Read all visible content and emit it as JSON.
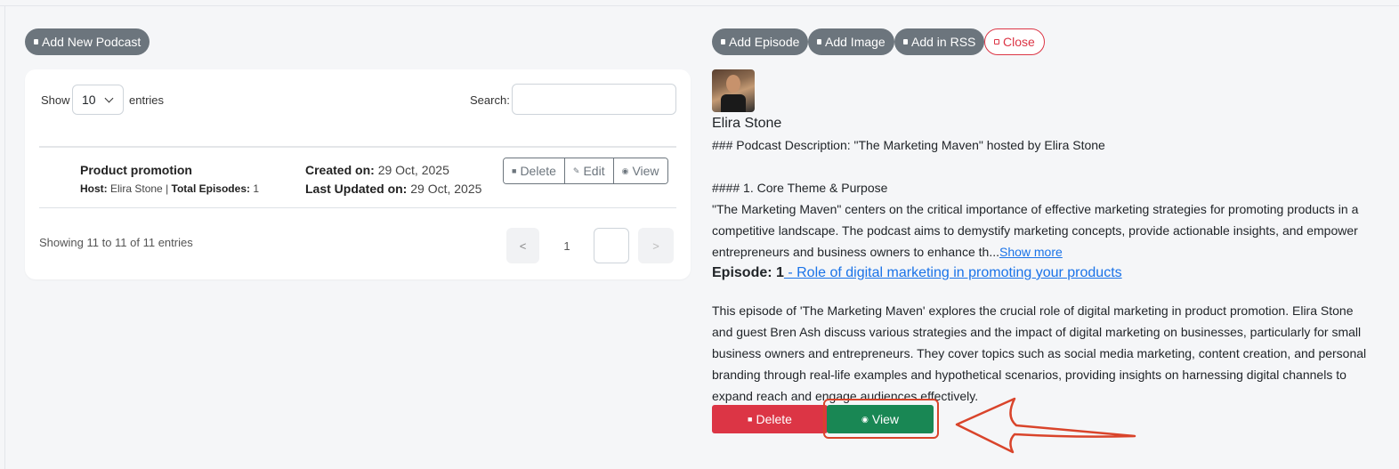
{
  "left": {
    "add_podcast_label": "Add New Podcast",
    "show_label": "Show",
    "entries_value": "10",
    "entries_label": "entries",
    "search_label": "Search:",
    "search_value": "",
    "row": {
      "title": "Product promotion",
      "host_label": "Host:",
      "host_value": "Elira Stone",
      "separator": "|",
      "total_label": "Total Episodes:",
      "total_value": "1",
      "created_label": "Created on:",
      "created_value": "29 Oct, 2025",
      "updated_label": "Last Updated on:",
      "updated_value": "29 Oct, 2025",
      "delete_label": "Delete",
      "edit_label": "Edit",
      "view_label": "View"
    },
    "showing_text": "Showing 11 to 11 of 11 entries",
    "pagination": {
      "prev": "<",
      "page": "1",
      "next": ">"
    }
  },
  "right": {
    "toolbar": {
      "add_episode": "Add Episode",
      "add_image": "Add Image",
      "add_rss": "Add in RSS",
      "close": "Close"
    },
    "host_name": "Elira Stone",
    "desc_heading": "### Podcast Description: \"The Marketing Maven\" hosted by Elira Stone",
    "desc_subheading": "#### 1. Core Theme & Purpose",
    "desc_line1": "\"The Marketing Maven\" centers on the critical importance of effective marketing strategies for promoting products in a",
    "desc_line2": "competitive landscape. The podcast aims to demystify marketing concepts, provide actionable insights, and empower",
    "desc_line3": "entrepreneurs and business owners to enhance th...",
    "show_more": "Show more",
    "episode_label": "Episode: 1",
    "episode_title": " - Role of digital marketing in promoting your products",
    "episode_desc": [
      "This episode of 'The Marketing Maven' explores the crucial role of digital marketing in product promotion. Elira Stone",
      "and guest Bren Ash discuss various strategies and the impact of digital marketing on businesses, particularly for small",
      "business owners and entrepreneurs. They cover topics such as social media marketing, content creation, and personal",
      "branding through real-life examples and hypothetical scenarios, providing insights on harnessing digital channels to",
      "expand reach and engage audiences effectively."
    ],
    "delete_label": "Delete",
    "view_label": "View"
  },
  "colors": {
    "secondary": "#6c757d",
    "danger": "#dc3545",
    "success": "#198754",
    "annotation": "#d9442b",
    "link": "#1a73e8"
  },
  "icons": [
    "square-icon",
    "trash-icon",
    "edit-icon",
    "eye-icon",
    "chevron-down-icon",
    "arrow-annotation"
  ]
}
